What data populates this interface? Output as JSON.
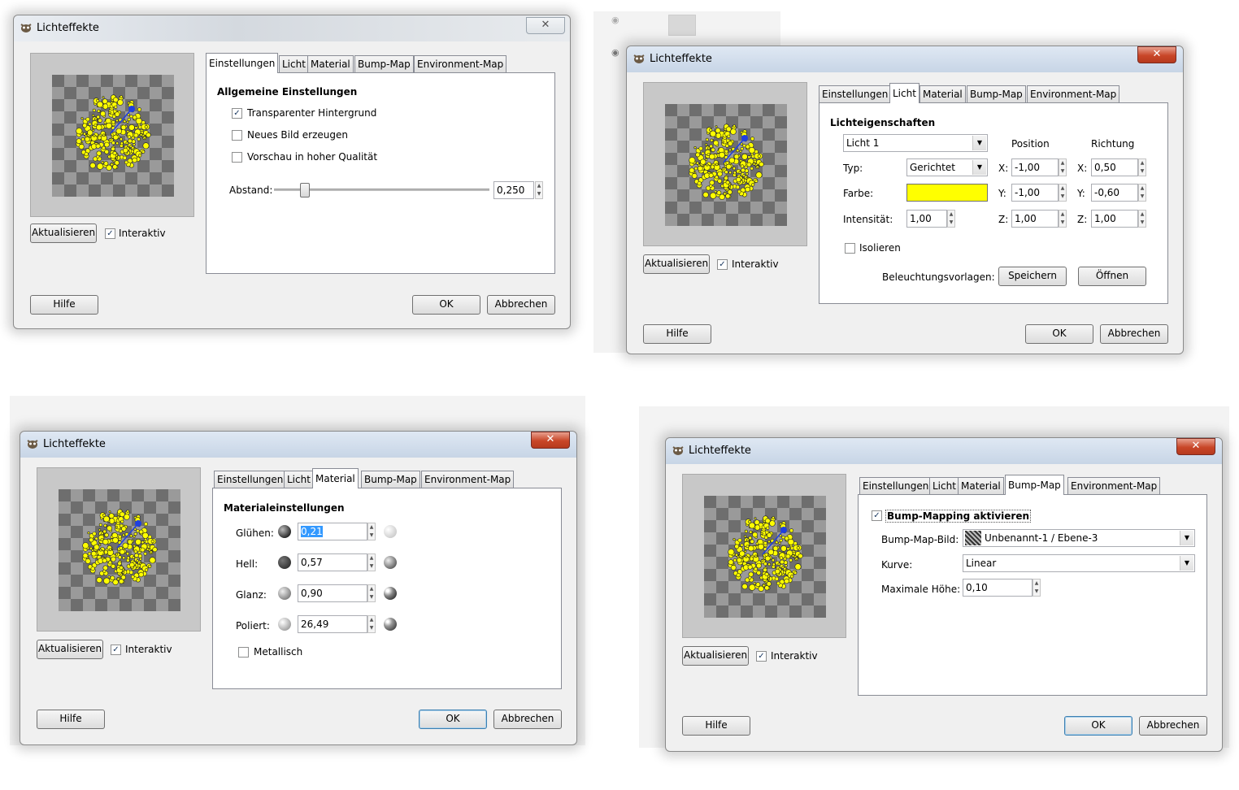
{
  "title": "Lichteffekte",
  "close_glyph": "✕",
  "check_glyph": "✓",
  "common": {
    "update_button": "Aktualisieren",
    "interactive_label": "Interaktiv",
    "help_button": "Hilfe",
    "ok_button": "OK",
    "cancel_button": "Abbrechen"
  },
  "tabs": [
    "Einstellungen",
    "Licht",
    "Material",
    "Bump-Map",
    "Environment-Map"
  ],
  "settings": {
    "heading": "Allgemeine Einstellungen",
    "transparent_bg": "Transparenter Hintergrund",
    "new_image": "Neues Bild erzeugen",
    "hq_preview": "Vorschau in hoher Qualität",
    "distance_label": "Abstand:",
    "distance_value": "0,250",
    "distance_fraction": 0.14
  },
  "light": {
    "heading": "Lichteigenschaften",
    "light_select": "Licht 1",
    "position_header": "Position",
    "direction_header": "Richtung",
    "type_label": "Typ:",
    "type_value": "Gerichtet",
    "color_label": "Farbe:",
    "color": "#ffff00",
    "intensity_label": "Intensität:",
    "intensity_value": "1,00",
    "pos_x_label": "X:",
    "pos_x": "-1,00",
    "pos_y_label": "Y:",
    "pos_y": "-1,00",
    "pos_z_label": "Z:",
    "pos_z": "1,00",
    "dir_x_label": "X:",
    "dir_x": "0,50",
    "dir_y_label": "Y:",
    "dir_y": "-0,60",
    "dir_z_label": "Z:",
    "dir_z": "1,00",
    "isolate_label": "Isolieren",
    "presets_label": "Beleuchtungsvorlagen:",
    "save_button": "Speichern",
    "open_button": "Öffnen"
  },
  "material": {
    "heading": "Materialeinstellungen",
    "glow_label": "Glühen:",
    "glow_value": "0,21",
    "bright_label": "Hell:",
    "bright_value": "0,57",
    "shine_label": "Glanz:",
    "shine_value": "0,90",
    "polish_label": "Poliert:",
    "polish_value": "26,49",
    "metallic_label": "Metallisch"
  },
  "bumpmap": {
    "enable_label": "Bump-Mapping aktivieren",
    "image_label": "Bump-Map-Bild:",
    "image_value": "Unbenannt-1 / Ebene-3",
    "curve_label": "Kurve:",
    "curve_value": "Linear",
    "max_height_label": "Maximale Höhe:",
    "max_height_value": "0,10"
  },
  "colors": {
    "light_swatch": "#ffff00",
    "light_marker": "#1f3fe0",
    "pattern_yellow": "#ffff00"
  }
}
